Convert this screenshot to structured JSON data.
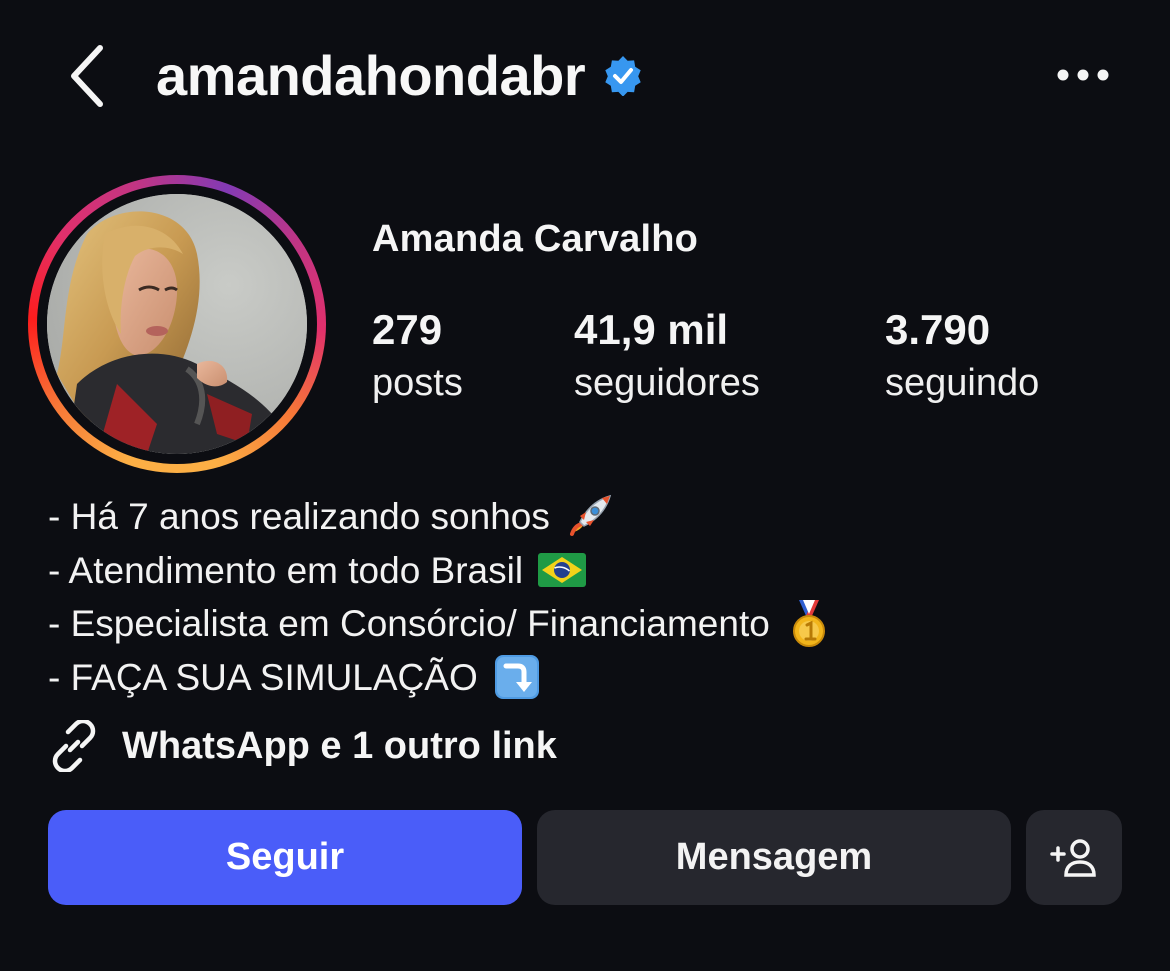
{
  "header": {
    "username": "amandahondabr",
    "verified": true,
    "icons": {
      "back": "chevron-left-icon",
      "more": "more-horizontal-icon",
      "verified": "verified-badge-icon"
    }
  },
  "profile": {
    "display_name": "Amanda Carvalho",
    "stats": [
      {
        "value": "279",
        "label": "posts"
      },
      {
        "value": "41,9 mil",
        "label": "seguidores"
      },
      {
        "value": "3.790",
        "label": "seguindo"
      }
    ],
    "has_story_ring": true
  },
  "bio": {
    "lines": [
      {
        "text": "- Há 7 anos realizando sonhos",
        "emoji": "rocket-emoji"
      },
      {
        "text": "- Atendimento em todo Brasil",
        "emoji": "brazil-flag-emoji"
      },
      {
        "text": "- Especialista em Consórcio/ Financiamento",
        "emoji": "medal-emoji"
      },
      {
        "text": "- FAÇA SUA SIMULAÇÃO",
        "emoji": "arrow-down-right-emoji"
      }
    ]
  },
  "links": {
    "text": "WhatsApp e 1 outro link",
    "icon": "link-icon"
  },
  "actions": {
    "follow_label": "Seguir",
    "message_label": "Mensagem",
    "add_user_icon": "add-user-icon"
  },
  "colors": {
    "background": "#0c0d12",
    "primary_button": "#4a5df9",
    "secondary_button": "#26272e",
    "verified_badge": "#3797f0"
  }
}
